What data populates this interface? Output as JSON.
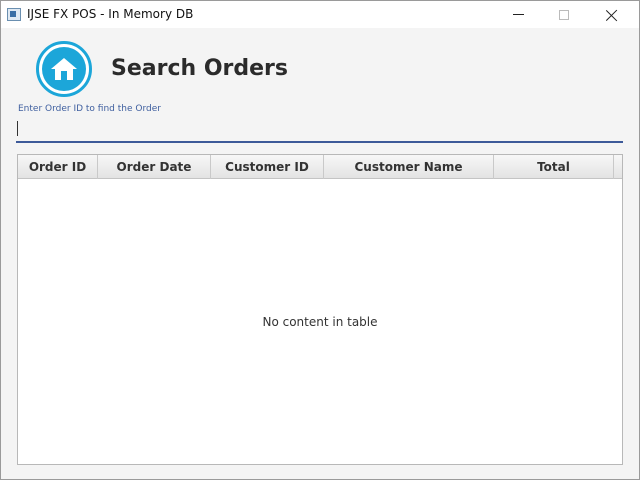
{
  "window": {
    "title": "IJSE FX POS - In Memory DB",
    "app_icon": "window-app-icon",
    "controls": [
      "minimize-icon",
      "maximize-icon",
      "close-icon"
    ]
  },
  "header": {
    "home_icon": "home-icon",
    "title": "Search Orders"
  },
  "search": {
    "label": "Enter Order ID to find the Order",
    "value": "",
    "placeholder": ""
  },
  "table": {
    "columns": [
      "Order ID",
      "Order Date",
      "Customer ID",
      "Customer Name",
      "Total"
    ],
    "rows": [],
    "empty_message": "No content in table"
  },
  "colors": {
    "accent": "#1ca6d9",
    "field_underline": "#3d5a99",
    "label": "#3f5f9f"
  }
}
